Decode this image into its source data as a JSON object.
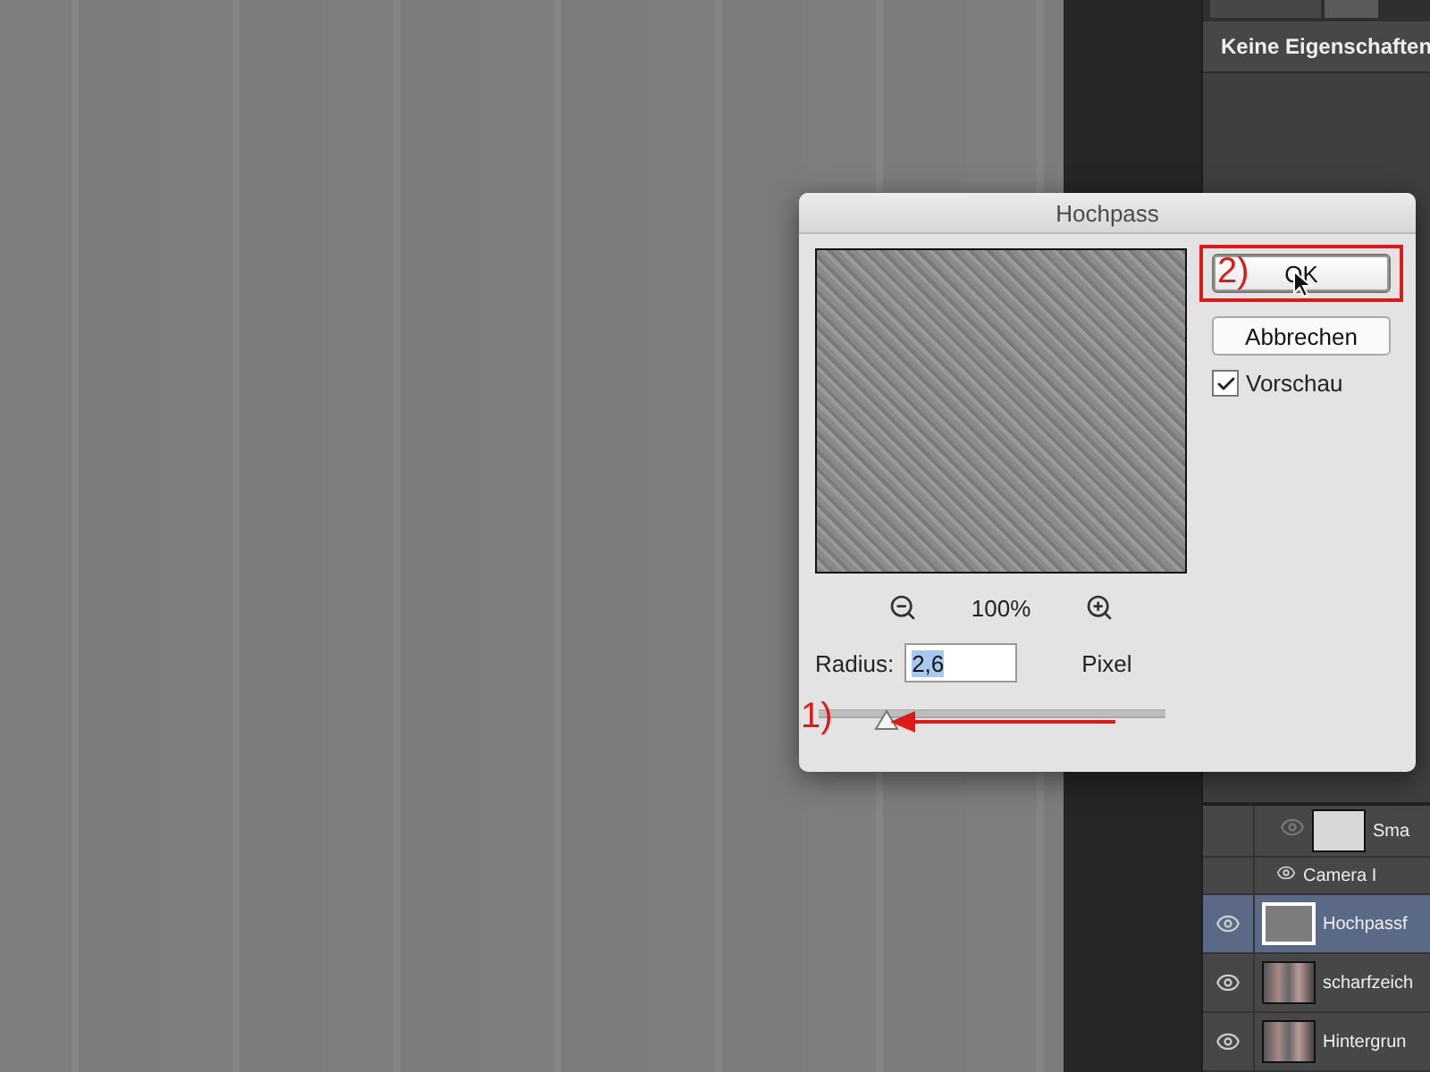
{
  "properties": {
    "message": "Keine Eigenschaften"
  },
  "dialog": {
    "title": "Hochpass",
    "zoom": "100%",
    "radius_label": "Radius:",
    "radius_value": "2,6",
    "unit": "Pixel",
    "radius_slider": {
      "level": 0.17
    },
    "buttons": [
      {
        "label": "OK",
        "default": true
      },
      {
        "label": "Abbrechen",
        "default": false
      }
    ],
    "preview_checkbox": {
      "label": "Vorschau",
      "checked": true
    }
  },
  "annotations": [
    {
      "label": "1)",
      "kind": "arrow"
    },
    {
      "label": "2)",
      "kind": "frame"
    }
  ],
  "layers": [
    {
      "name": "Sma",
      "kind": "mask",
      "visible": true,
      "selected": false
    },
    {
      "name": "Camera I",
      "kind": "filter",
      "visible": true,
      "selected": false
    },
    {
      "name": "Hochpassf",
      "kind": "layer",
      "visible": true,
      "selected": true
    },
    {
      "name": "scharfzeich",
      "kind": "layer",
      "visible": true,
      "selected": false
    },
    {
      "name": "Hintergrun",
      "kind": "layer",
      "visible": true,
      "selected": false
    }
  ]
}
